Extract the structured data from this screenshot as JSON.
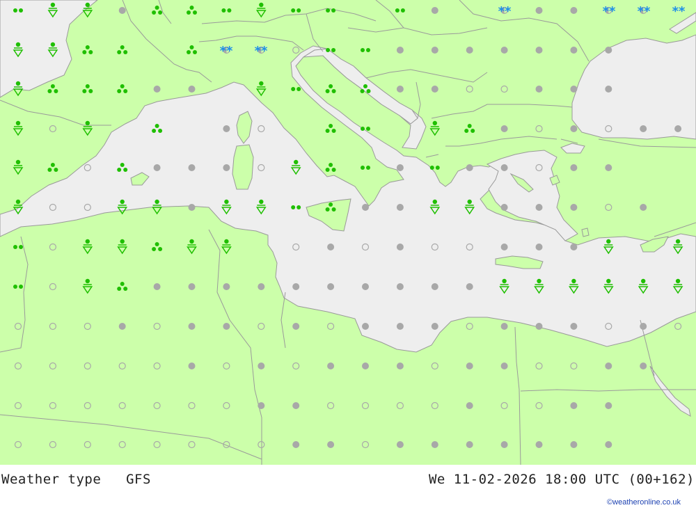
{
  "footer": {
    "title": "Weather type   GFS",
    "datetime": "We 11-02-2026 18:00 UTC (00+162)",
    "credit": "©weatheronline.co.uk"
  },
  "colors": {
    "land": "#ccffaa",
    "sea": "#eeeeee",
    "border": "#9a9a9a",
    "rain": "#1fbf00",
    "snow": "#1e8fe8",
    "cloud": "#a8a8a8"
  },
  "icon_legend": {
    "overcast": "overcast-dot-icon",
    "clear": "clear-ring-icon",
    "partly_cloudy": "half-filled-ring-icon",
    "rain": "rain-triangle-icon",
    "drizzle": "drizzle-dots-icon",
    "showers": "shower-trefoil-icon",
    "snow": "snow-asterisks-icon"
  },
  "symbol_grid": [
    "R T T O S S D T D D  D O  N O O N N",
    "T T S S  S N N H D D O O O O O O O",
    "T S S S O O  T D S S O O H H O O O",
    "T H T  S  O H  S D  T S O H O H O O",
    "T S H S O O O H T S D O D O O H O O",
    "T H H T T O T T D S O O T T O O O H O",
    "D H T T S T T  H O H O H H O O O T  T T",
    "D H T S O O O O O O O O O O T T T T T T",
    "H H H O H O O H O H O O O H O O O H O H",
    "H H H H H O H O H O O O H O O H H O O",
    "H H H H H H H O O H H H H O H H O O",
    "H H H H H H H H O O H O O O O O O O"
  ]
}
